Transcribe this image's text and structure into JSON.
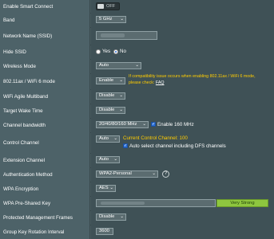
{
  "rows": {
    "smart_connect": {
      "label": "Enable Smart Connect",
      "toggle_text": "OFF"
    },
    "band": {
      "label": "Band",
      "value": "5 GHz"
    },
    "ssid": {
      "label": "Network Name (SSID)"
    },
    "hide_ssid": {
      "label": "Hide SSID",
      "yes": "Yes",
      "no": "No",
      "selected": "No"
    },
    "wireless_mode": {
      "label": "Wireless Mode",
      "value": "Auto"
    },
    "ax_mode": {
      "label": "802.11ax / WiFi 6 mode",
      "value": "Enable",
      "note_line1": "If compatibility issue occurs when enabling 802.11ax / WiFi 6 mode,",
      "note_line2": "please check: ",
      "faq_link": "FAQ"
    },
    "agile_multiband": {
      "label": "WiFi Agile Multiband",
      "value": "Disable"
    },
    "target_wake_time": {
      "label": "Target Wake Time",
      "value": "Disable"
    },
    "channel_bandwidth": {
      "label": "Channel bandwidth",
      "value": "20/40/80/160 MHz",
      "checkbox_label": "Enable 160 MHz"
    },
    "control_channel": {
      "label": "Control Channel",
      "value": "Auto",
      "current": "Current Control Channel: 100",
      "checkbox_label": "Auto select channel including DFS channels"
    },
    "extension_channel": {
      "label": "Extension Channel",
      "value": "Auto"
    },
    "auth_method": {
      "label": "Authentication Method",
      "value": "WPA2-Personal",
      "help_icon": "?"
    },
    "wpa_encryption": {
      "label": "WPA Encryption",
      "value": "AES"
    },
    "wpa_key": {
      "label": "WPA Pre-Shared Key",
      "strength": "Very Strong"
    },
    "pmf": {
      "label": "Protected Management Frames",
      "value": "Disable"
    },
    "gkri": {
      "label": "Group Key Rotation Interval",
      "value": "3600"
    }
  },
  "colors": {
    "accent_yellow": "#ffcc00",
    "strength_green": "#8ec63f",
    "checkbox_blue": "#2a6fd6"
  }
}
